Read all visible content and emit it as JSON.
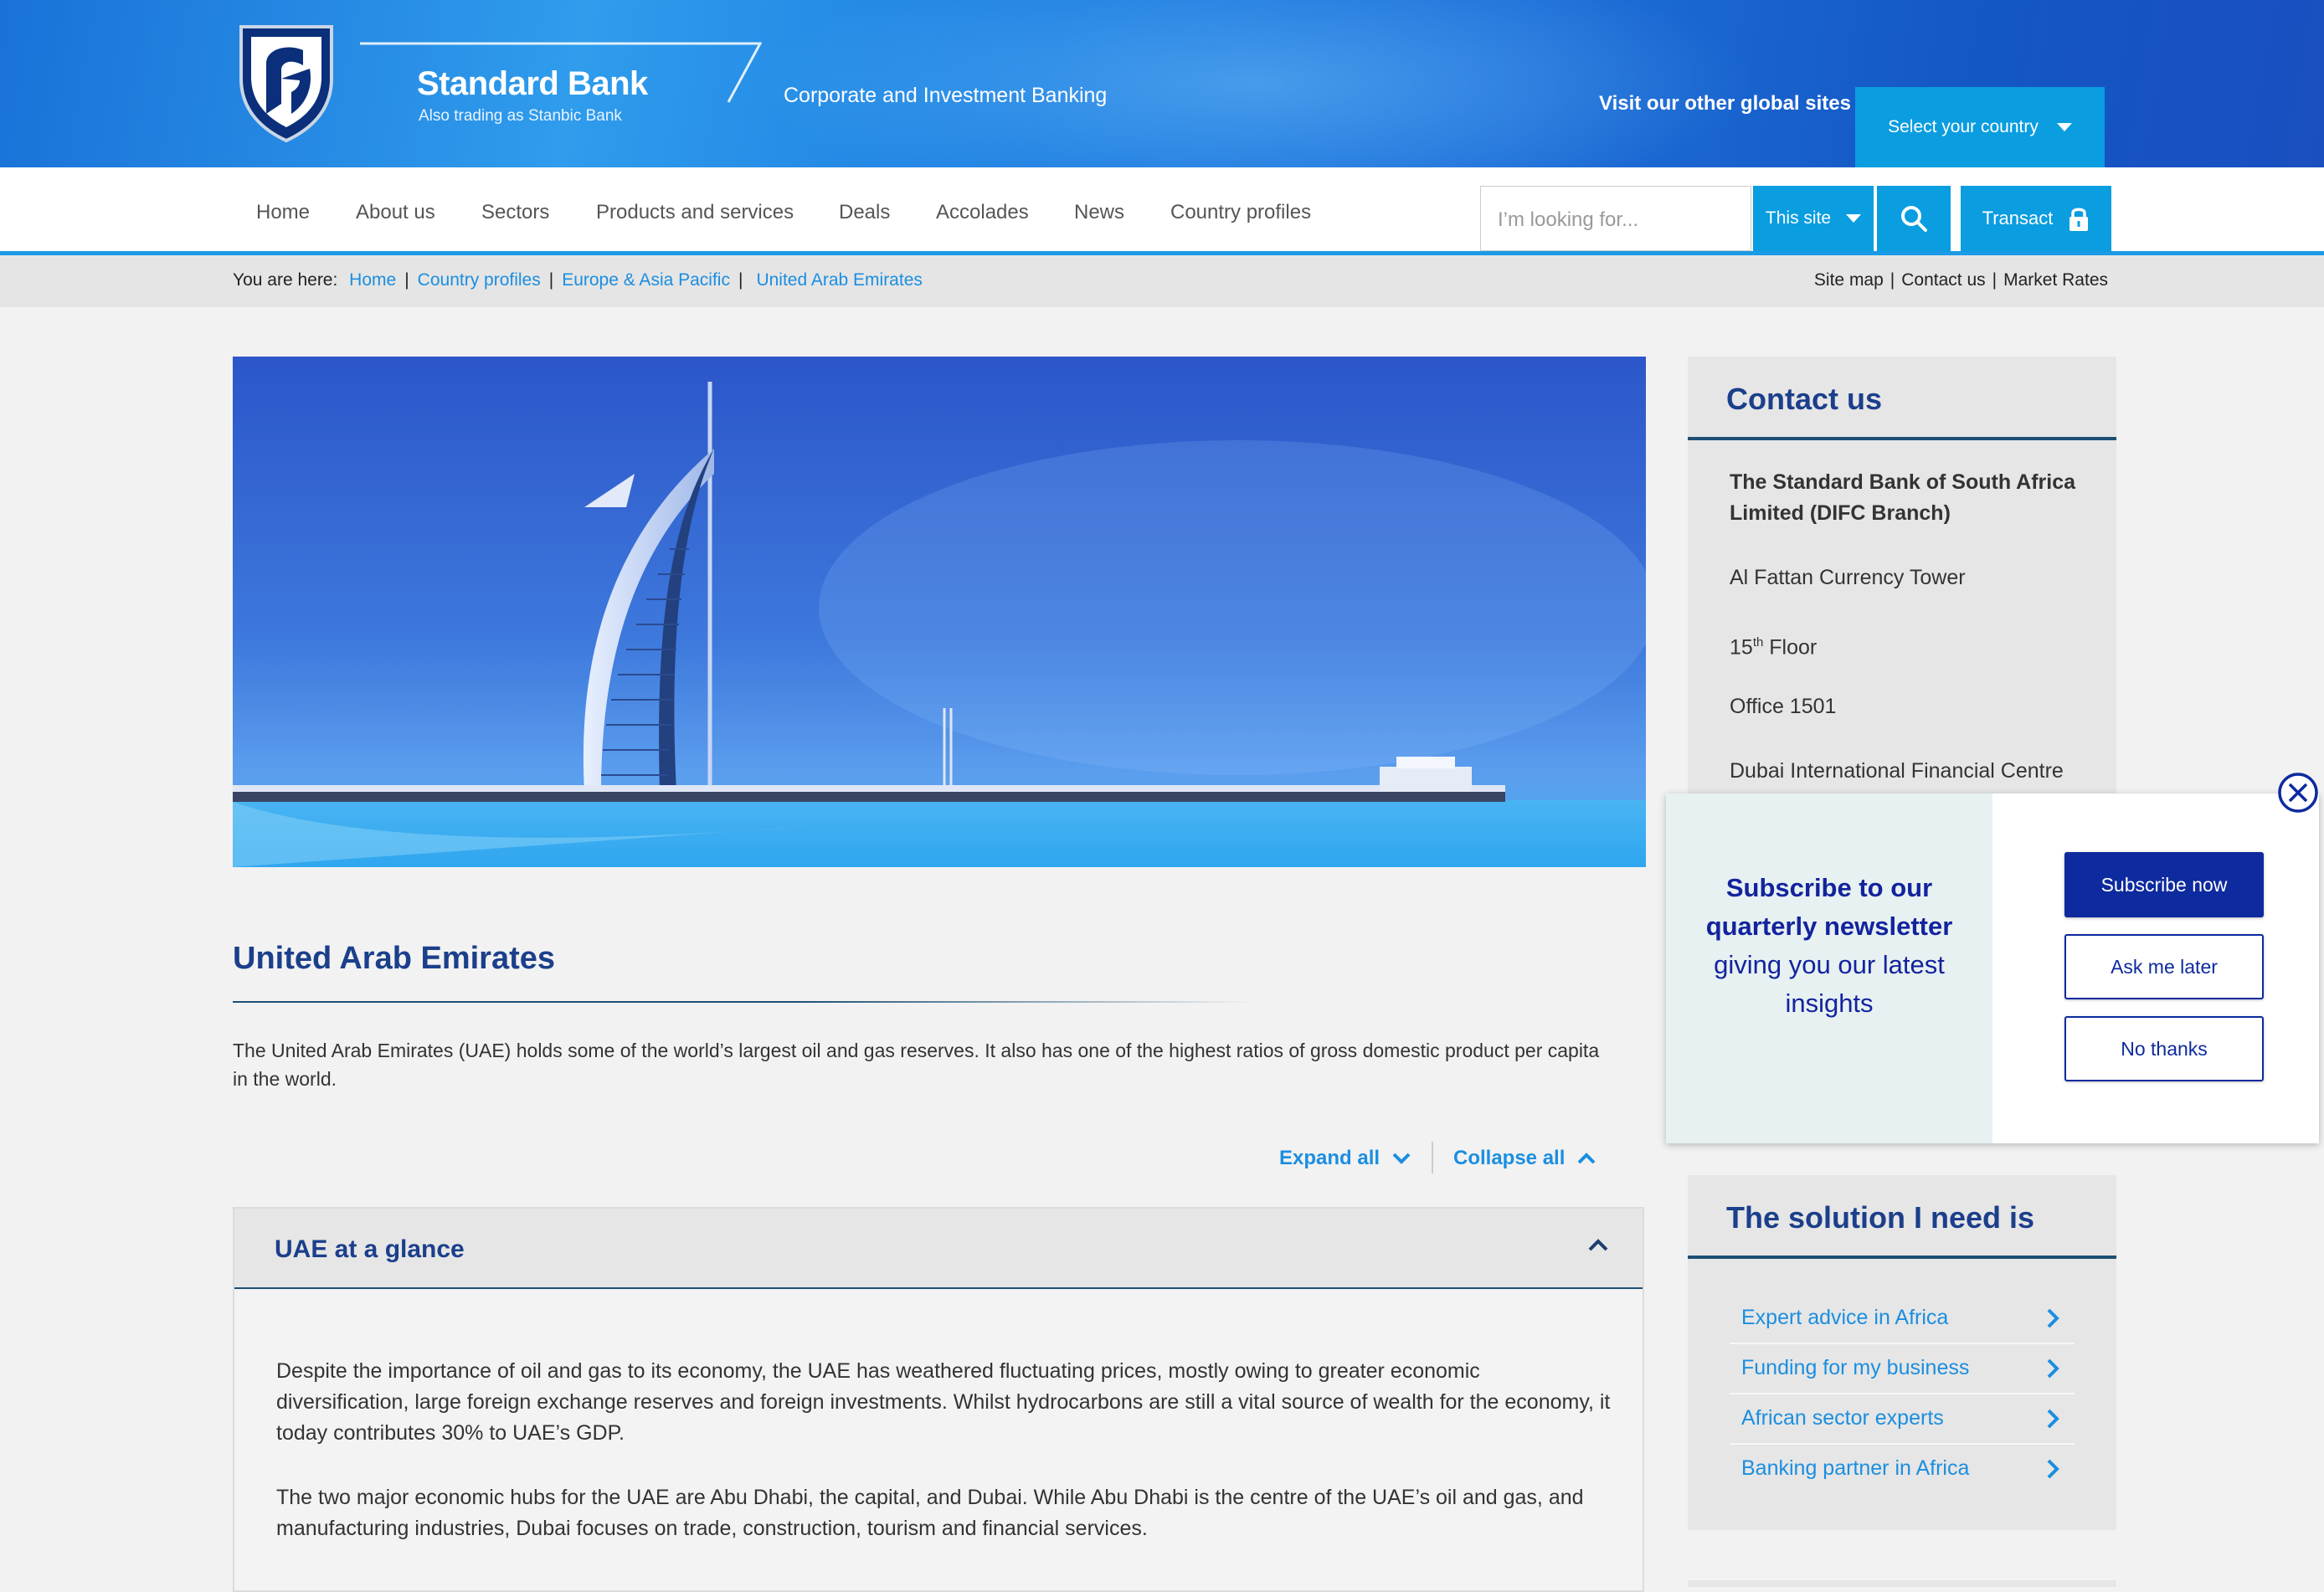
{
  "header": {
    "brand_name": "Standard Bank",
    "brand_sub": "Also trading as Stanbic Bank",
    "tagline": "Corporate and Investment Banking",
    "global_sites_label": "Visit our other global sites",
    "country_select": "Select your country"
  },
  "nav": {
    "items": [
      "Home",
      "About us",
      "Sectors",
      "Products and services",
      "Deals",
      "Accolades",
      "News",
      "Country profiles"
    ],
    "search_placeholder": "I’m looking for...",
    "search_scope": "This site",
    "transact_label": "Transact"
  },
  "breadcrumb": {
    "prefix": "You are here:",
    "items": [
      "Home",
      "Country profiles",
      "Europe & Asia Pacific",
      "United Arab Emirates"
    ]
  },
  "utility_links": [
    "Site map",
    "Contact us",
    "Market Rates"
  ],
  "main": {
    "title": "United Arab Emirates",
    "intro": "The United Arab Emirates (UAE) holds some of the world’s largest oil and gas reserves. It also has one of the highest ratios of gross domestic product per capita in the world.",
    "expand_all": "Expand all",
    "collapse_all": "Collapse all",
    "accordion": {
      "title": "UAE at a glance",
      "paragraphs": [
        "Despite the importance of oil and gas to its economy, the UAE has weathered fluctuating prices, mostly owing to greater economic diversification, large foreign exchange reserves and foreign investments.  Whilst hydrocarbons are still a vital source of wealth for the economy, it today contributes 30% to UAE’s GDP.",
        "The two major economic hubs for the UAE are Abu Dhabi, the capital, and Dubai. While Abu Dhabi is the centre of the UAE’s oil and gas, and manufacturing industries, Dubai focuses on trade, construction, tourism and financial services."
      ]
    }
  },
  "contact": {
    "title": "Contact us",
    "org": "The Standard Bank of South Africa Limited (DIFC Branch)",
    "line1": "Al Fattan Currency Tower",
    "floor_num": "15",
    "floor_sup": "th",
    "floor_word": " Floor",
    "office": "Office 1501",
    "centre": "Dubai International Financial Centre"
  },
  "popup": {
    "headline": "Subscribe to our quarterly newsletter",
    "subline": "giving you our latest insights",
    "subscribe": "Subscribe now",
    "later": "Ask me later",
    "no_thanks": "No thanks"
  },
  "solutions": {
    "title": "The solution I need is",
    "items": [
      "Expert advice in Africa",
      "Funding for my business",
      "African sector experts",
      "Banking partner in Africa"
    ]
  },
  "colors": {
    "brand_blue": "#1b3f8b",
    "link_blue": "#1b8ee0",
    "button_blue": "#0a9de0",
    "popup_navy": "#0d2a9e"
  }
}
